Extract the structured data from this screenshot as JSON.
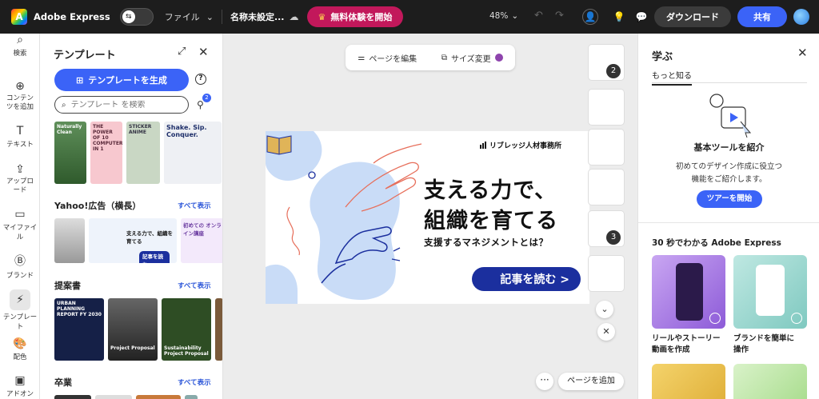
{
  "topbar": {
    "logo_letter": "A",
    "app_name": "Adobe Express",
    "file_menu": "ファイル",
    "doc_name": "名称未設定...",
    "trial_label": "無料体験を開始",
    "zoom": "48%",
    "download_label": "ダウンロード",
    "share_label": "共有"
  },
  "rail": {
    "items": [
      {
        "label": "検索"
      },
      {
        "label": "コンテンツを追加"
      },
      {
        "label": "テキスト"
      },
      {
        "label": "アップロード"
      },
      {
        "label": "マイファイル"
      },
      {
        "label": "ブランド"
      },
      {
        "label": "テンプレート"
      },
      {
        "label": "配色"
      },
      {
        "label": "アドオン"
      }
    ]
  },
  "templates": {
    "title": "テンプレート",
    "generate_label": "テンプレートを生成",
    "search_placeholder": "テンプレート を検索",
    "filter_badge": "2",
    "top_thumbs": [
      "Naturally Clean",
      "THE POWER OF 10 COMPUTER IN 1",
      "STICKER ANIME",
      "Shake. Sip. Conquer."
    ],
    "sections": [
      {
        "title": "Yahoo!広告（横長）",
        "more": "すべて表示"
      },
      {
        "title": "提案書",
        "more": "すべて表示"
      },
      {
        "title": "卒業",
        "more": "すべて表示"
      }
    ],
    "yahoo_thumb_text": "支える力で、組織を育てる",
    "yahoo_thumb_btn": "記事を読む",
    "yahoo_thumb3_title": "初めての オンライン講座",
    "proposal_thumbs": [
      "URBAN PLANNING REPORT FY 2030",
      "Project Proposal",
      "Sustainability Project Proposal"
    ]
  },
  "canvas": {
    "edit_page_label": "ページを編集",
    "resize_label": "サイズ変更",
    "banner": {
      "company": "リブレッジ人材事務所",
      "headline1": "支える力で、",
      "headline2": "組織を育てる",
      "subhead": "支援するマネジメントとは？",
      "cta": "記事を読む >"
    },
    "page_badges": [
      "2",
      "3"
    ],
    "add_page_label": "ページを追加",
    "more_label": "···"
  },
  "learn": {
    "title": "学ぶ",
    "tab": "もっと知る",
    "heading": "基本ツールを紹介",
    "desc1": "初めてのデザイン作成に役立つ",
    "desc2": "機能をご紹介します。",
    "tour_label": "ツアーを開始",
    "section_title": "30 秒でわかる Adobe Express",
    "videos": [
      {
        "label1": "リールやストーリー",
        "label2": "動画を作成"
      },
      {
        "label1": "ブランドを簡単に",
        "label2": "操作"
      }
    ]
  },
  "colors": {
    "accent": "#3b63f7",
    "trial": "#c2185b",
    "banner_navy": "#1b2f9e",
    "banner_blob": "#c9dcf7"
  }
}
